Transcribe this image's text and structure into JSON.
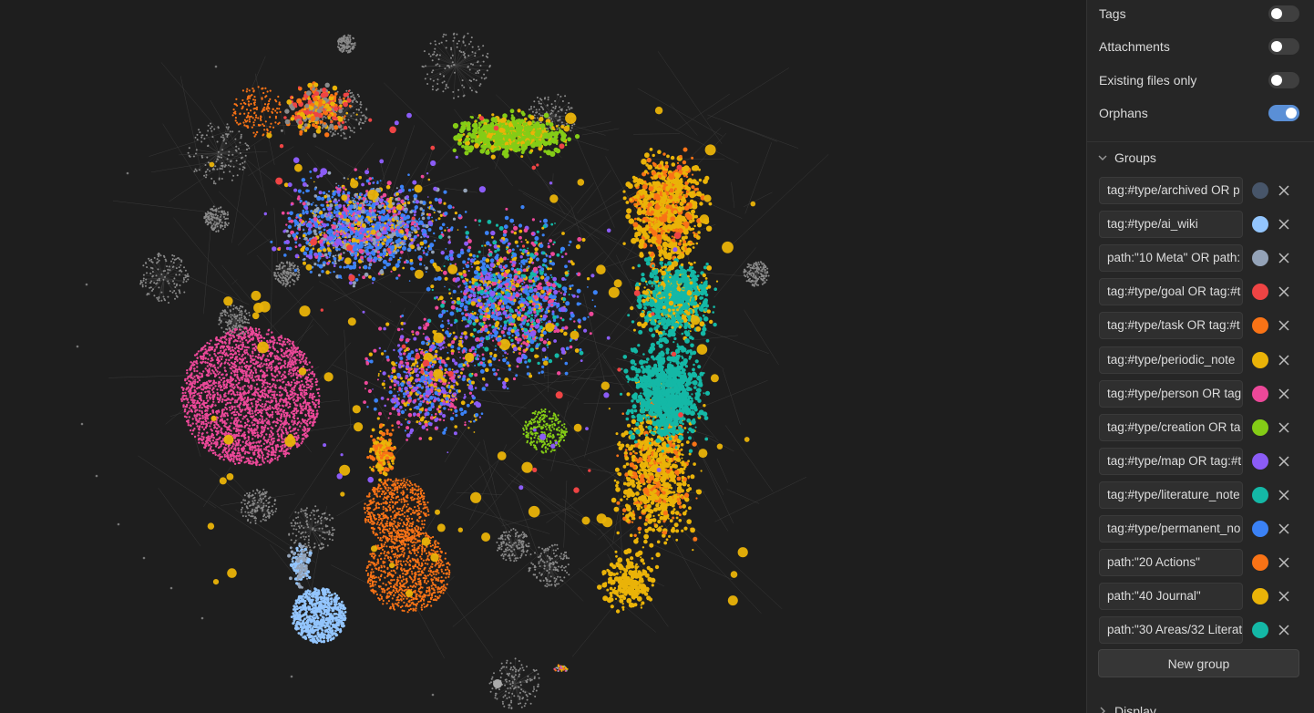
{
  "filters": {
    "toggles": [
      {
        "label": "Tags",
        "on": false
      },
      {
        "label": "Attachments",
        "on": false
      },
      {
        "label": "Existing files only",
        "on": false
      },
      {
        "label": "Orphans",
        "on": true
      }
    ]
  },
  "groups": {
    "header": "Groups",
    "items": [
      {
        "query": "tag:#type/archived OR p",
        "color": "#475569"
      },
      {
        "query": "tag:#type/ai_wiki",
        "color": "#93c5fd"
      },
      {
        "query": "path:\"10 Meta\" OR path:",
        "color": "#94a3b8"
      },
      {
        "query": "tag:#type/goal OR tag:#t",
        "color": "#ef4444"
      },
      {
        "query": "tag:#type/task OR tag:#t",
        "color": "#f97316"
      },
      {
        "query": "tag:#type/periodic_note",
        "color": "#eab308"
      },
      {
        "query": "tag:#type/person OR tag",
        "color": "#ec4899"
      },
      {
        "query": "tag:#type/creation OR ta",
        "color": "#84cc16"
      },
      {
        "query": "tag:#type/map OR tag:#t",
        "color": "#8b5cf6"
      },
      {
        "query": "tag:#type/literature_note",
        "color": "#14b8a6"
      },
      {
        "query": "tag:#type/permanent_no",
        "color": "#3b82f6"
      },
      {
        "query": "path:\"20 Actions\"",
        "color": "#f97316"
      },
      {
        "query": "path:\"40 Journal\"",
        "color": "#eab308"
      },
      {
        "query": "path:\"30 Areas/32 Literat",
        "color": "#14b8a6"
      }
    ],
    "new_group_label": "New group"
  },
  "display": {
    "header": "Display"
  },
  "icons": {
    "collapse": "chevron-down-icon",
    "expand": "chevron-right-icon",
    "remove": "close-icon"
  }
}
